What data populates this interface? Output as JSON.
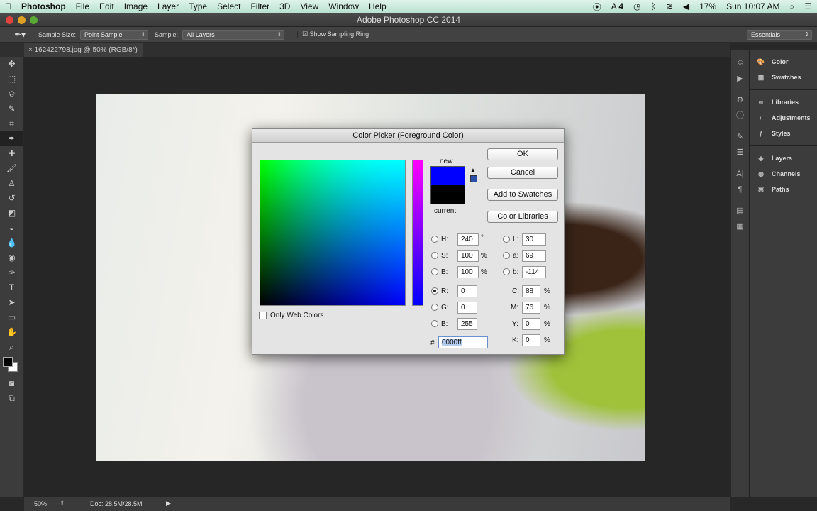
{
  "menubar": {
    "app": "Photoshop",
    "items": [
      "File",
      "Edit",
      "Image",
      "Layer",
      "Type",
      "Select",
      "Filter",
      "3D",
      "View",
      "Window",
      "Help"
    ],
    "status": {
      "adobe_count": "4",
      "battery": "17%",
      "clock": "Sun 10:07 AM"
    }
  },
  "window": {
    "title": "Adobe Photoshop CC 2014"
  },
  "options": {
    "sample_size_label": "Sample Size:",
    "sample_size_value": "Point Sample",
    "sample_label": "Sample:",
    "sample_value": "All Layers",
    "sampling_ring_label": "Show Sampling Ring",
    "sampling_ring_checked": true,
    "workspace": "Essentials"
  },
  "document": {
    "tab": "162422798.jpg @ 50% (RGB/8*)"
  },
  "statusbar": {
    "zoom": "50%",
    "doc": "Doc: 28.5M/28.5M"
  },
  "panels": {
    "groups": [
      [
        "Color",
        "Swatches"
      ],
      [
        "Libraries",
        "Adjustments",
        "Styles"
      ],
      [
        "Layers",
        "Channels",
        "Paths"
      ]
    ]
  },
  "dialog": {
    "title": "Color Picker (Foreground Color)",
    "new_label": "new",
    "current_label": "current",
    "new_color": "#0000ff",
    "current_color": "#000000",
    "buttons": {
      "ok": "OK",
      "cancel": "Cancel",
      "add": "Add to Swatches",
      "libraries": "Color Libraries"
    },
    "only_web": "Only Web Colors",
    "hsb": {
      "H": "240",
      "S": "100",
      "B": "100"
    },
    "lab": {
      "L": "30",
      "a": "69",
      "b": "-114"
    },
    "rgb": {
      "R": "0",
      "G": "0",
      "B": "255"
    },
    "cmyk": {
      "C": "88",
      "M": "76",
      "Y": "0",
      "K": "0"
    },
    "hex": "0000ff",
    "units": {
      "deg": "°",
      "pct": "%"
    },
    "labels": {
      "H": "H:",
      "S": "S:",
      "Bh": "B:",
      "L": "L:",
      "a": "a:",
      "b": "b:",
      "R": "R:",
      "G": "G:",
      "Bb": "B:",
      "C": "C:",
      "M": "M:",
      "Y": "Y:",
      "K": "K:",
      "hash": "#"
    }
  }
}
